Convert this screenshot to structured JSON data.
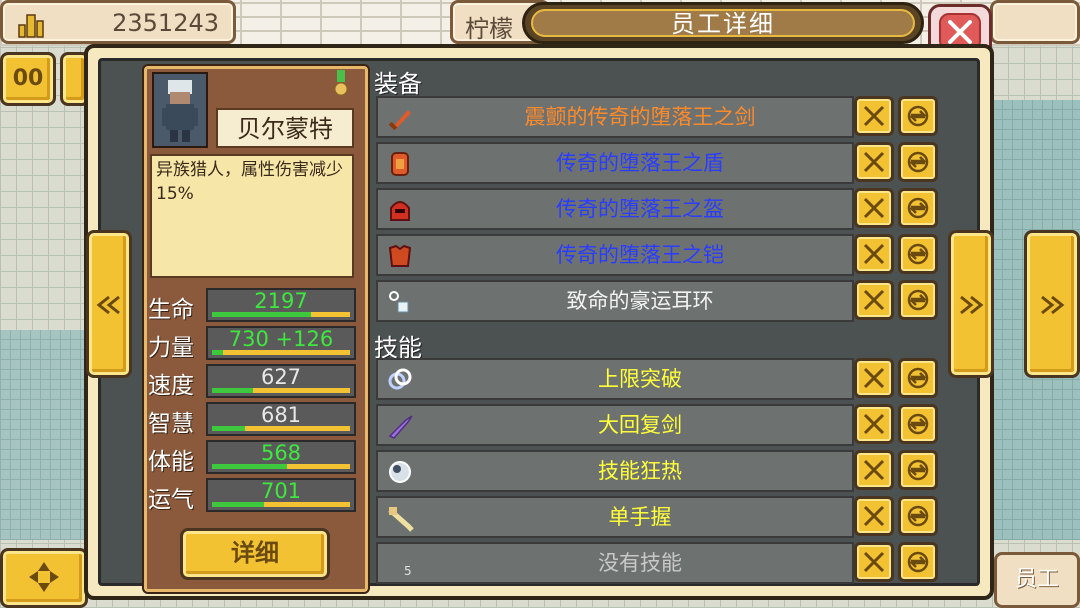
{
  "top": {
    "money": "2351243",
    "lemon_label": "柠檬",
    "title": "员工详细"
  },
  "character": {
    "name": "贝尔蒙特",
    "description": "异族猎人，属性伤害减少15%",
    "stats": [
      {
        "label": "生命",
        "value": "2197",
        "color": "green",
        "fill": 0.72
      },
      {
        "label": "力量",
        "value": "730 +126",
        "color": "green",
        "fill": 0.08
      },
      {
        "label": "速度",
        "value": "627",
        "color": "white",
        "fill": 0.3
      },
      {
        "label": "智慧",
        "value": "681",
        "color": "white",
        "fill": 0.24
      },
      {
        "label": "体能",
        "value": "568",
        "color": "green",
        "fill": 0.54
      },
      {
        "label": "运气",
        "value": "701",
        "color": "green",
        "fill": 0.38
      }
    ],
    "detail_button": "详细"
  },
  "equipment": {
    "heading": "装备",
    "items": [
      {
        "name": "震颤的传奇的堕落王之剑",
        "color": "#ff8a2a",
        "icon": "sword-icon"
      },
      {
        "name": "传奇的堕落王之盾",
        "color": "#2a3cff",
        "icon": "shield-icon"
      },
      {
        "name": "传奇的堕落王之盔",
        "color": "#2a3cff",
        "icon": "helmet-icon"
      },
      {
        "name": "传奇的堕落王之铠",
        "color": "#2a3cff",
        "icon": "armor-icon"
      },
      {
        "name": "致命的豪运耳环",
        "color": "#f2f2f2",
        "icon": "earring-icon"
      }
    ]
  },
  "skills": {
    "heading": "技能",
    "items": [
      {
        "name": "上限突破",
        "color": "#ffff3a",
        "icon": "link-icon"
      },
      {
        "name": "大回复剑",
        "color": "#ffff3a",
        "icon": "purple-sword-icon"
      },
      {
        "name": "技能狂热",
        "color": "#ffff3a",
        "icon": "orb-icon"
      },
      {
        "name": "单手握",
        "color": "#ffff3a",
        "icon": "hand-sword-icon"
      },
      {
        "name": "没有技能",
        "color": "#c8c8c8",
        "icon": "none"
      }
    ],
    "slot_number": "5"
  },
  "side": {
    "staff_tab": "员工",
    "pause": "00"
  }
}
